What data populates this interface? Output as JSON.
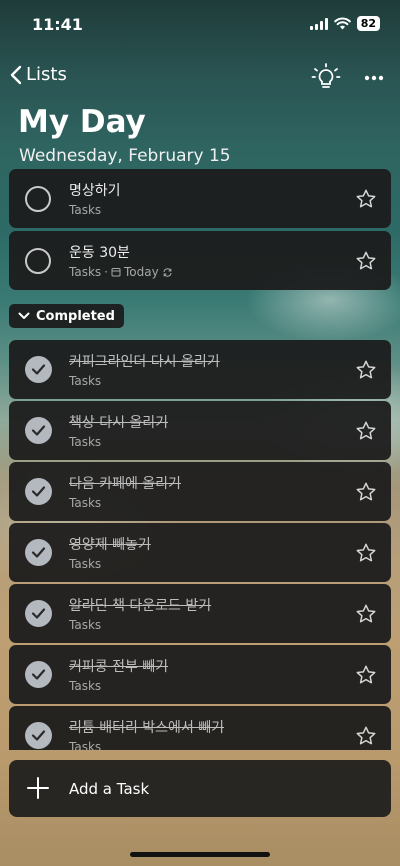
{
  "status": {
    "time": "11:41",
    "battery": "82"
  },
  "nav": {
    "back_label": "Lists",
    "bulb_icon": "lightbulb-icon",
    "more_icon": "ellipsis-icon"
  },
  "header": {
    "title": "My Day",
    "date": "Wednesday, February 15"
  },
  "open_tasks": [
    {
      "title": "명상하기",
      "list": "Tasks"
    },
    {
      "title": "운동 30분",
      "list": "Tasks",
      "due": "Today"
    }
  ],
  "completed_label": "Completed",
  "completed_tasks": [
    {
      "title": "커피그라인더 다시 올리기",
      "list": "Tasks"
    },
    {
      "title": "책상 다시 올리기",
      "list": "Tasks"
    },
    {
      "title": "다음 카페에 올리기",
      "list": "Tasks"
    },
    {
      "title": "영양제 빼놓기",
      "list": "Tasks"
    },
    {
      "title": "알라딘 책 다운로드 받기",
      "list": "Tasks"
    },
    {
      "title": "커피콩 전부 빼기",
      "list": "Tasks"
    },
    {
      "title": "리튬 배터리 박스에서 빼기",
      "list": "Tasks"
    }
  ],
  "add_task_label": "Add a Task",
  "colors": {
    "card_bg": "#1c1c1c",
    "check_fill": "#b4b8bf"
  }
}
